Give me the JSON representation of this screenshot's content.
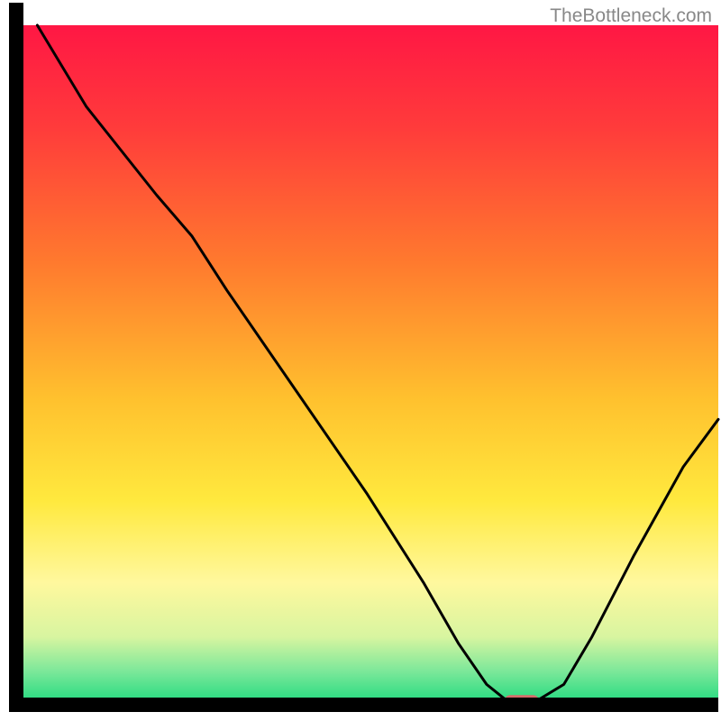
{
  "watermark": "TheBottleneck.com",
  "chart_data": {
    "type": "line",
    "title": "",
    "xlabel": "",
    "ylabel": "",
    "xlim": [
      0,
      100
    ],
    "ylim": [
      0,
      100
    ],
    "background_gradient": {
      "stops": [
        {
          "offset": 0,
          "color": "#ff1744"
        },
        {
          "offset": 15,
          "color": "#ff3b3b"
        },
        {
          "offset": 35,
          "color": "#ff7a2e"
        },
        {
          "offset": 55,
          "color": "#ffc12e"
        },
        {
          "offset": 70,
          "color": "#ffe93e"
        },
        {
          "offset": 82,
          "color": "#fff89e"
        },
        {
          "offset": 90,
          "color": "#d8f5a0"
        },
        {
          "offset": 95,
          "color": "#7de89a"
        },
        {
          "offset": 100,
          "color": "#1ed97e"
        }
      ]
    },
    "curve_points": [
      {
        "x": 3,
        "y": 100
      },
      {
        "x": 10,
        "y": 88
      },
      {
        "x": 20,
        "y": 75
      },
      {
        "x": 25,
        "y": 69
      },
      {
        "x": 30,
        "y": 61
      },
      {
        "x": 40,
        "y": 46
      },
      {
        "x": 50,
        "y": 31
      },
      {
        "x": 58,
        "y": 18
      },
      {
        "x": 63,
        "y": 9
      },
      {
        "x": 67,
        "y": 3
      },
      {
        "x": 70,
        "y": 0.5
      },
      {
        "x": 74,
        "y": 0.5
      },
      {
        "x": 78,
        "y": 3
      },
      {
        "x": 82,
        "y": 10
      },
      {
        "x": 88,
        "y": 22
      },
      {
        "x": 95,
        "y": 35
      },
      {
        "x": 100,
        "y": 42
      }
    ],
    "marker": {
      "x": 72,
      "y": 0.5,
      "color": "#d66b6b",
      "width": 5,
      "height": 2
    },
    "border_color": "#000000",
    "line_color": "#000000"
  }
}
